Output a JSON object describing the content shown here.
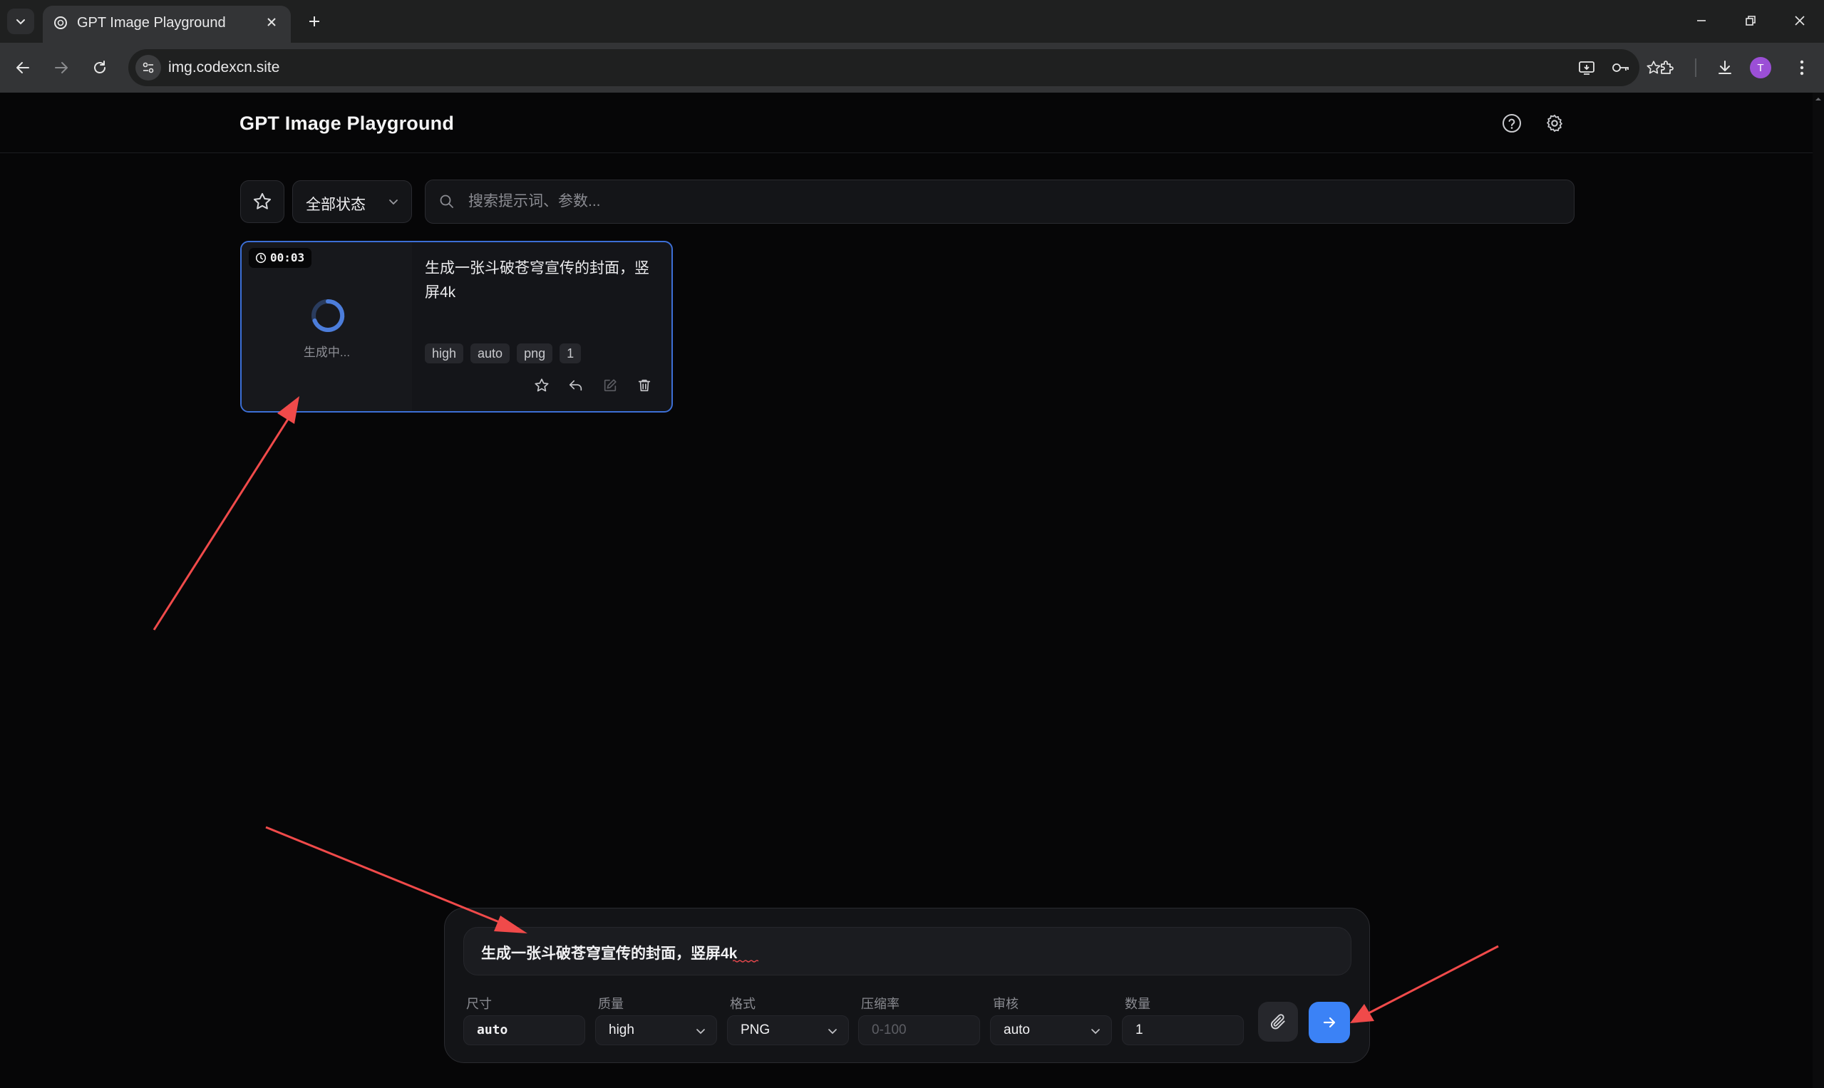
{
  "browser": {
    "tab_title": "GPT Image Playground",
    "url": "img.codexcn.site",
    "avatar_letter": "T",
    "avatar_color": "#9b4fd6"
  },
  "app": {
    "title": "GPT Image Playground",
    "accent_color": "#3b82f6"
  },
  "filters": {
    "status_selected": "全部状态",
    "search_placeholder": "搜索提示词、参数..."
  },
  "task_card": {
    "timer": "00:03",
    "status_text": "生成中...",
    "prompt": "生成一张斗破苍穹宣传的封面，竖屏4k",
    "tags": [
      "high",
      "auto",
      "png",
      "1"
    ]
  },
  "composer": {
    "prompt_value": "生成一张斗破苍穹宣传的封面，竖屏4k",
    "fields": {
      "size": {
        "label": "尺寸",
        "value": "auto"
      },
      "quality": {
        "label": "质量",
        "value": "high"
      },
      "format": {
        "label": "格式",
        "value": "PNG"
      },
      "compression": {
        "label": "压缩率",
        "placeholder": "0-100"
      },
      "moderation": {
        "label": "审核",
        "value": "auto"
      },
      "count": {
        "label": "数量",
        "value": "1"
      }
    }
  },
  "annotation_color": "#f04a4a"
}
